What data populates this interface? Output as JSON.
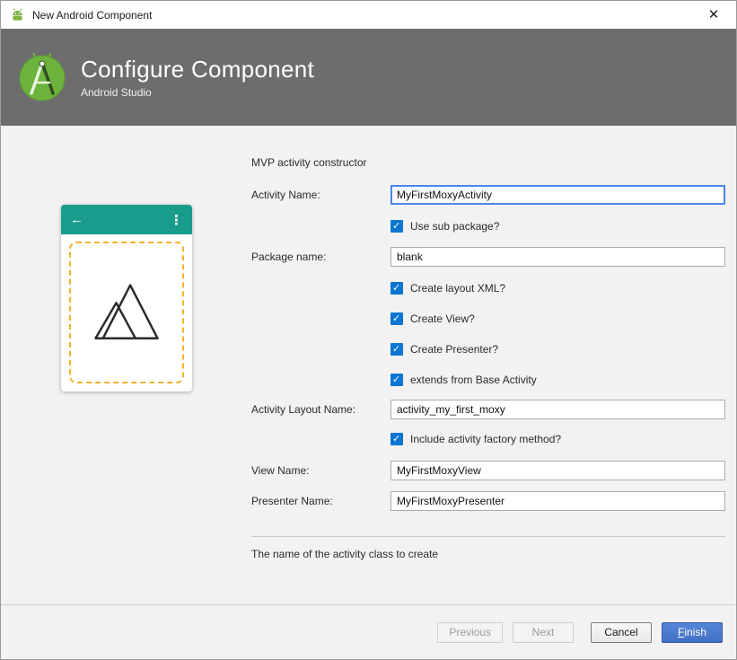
{
  "window": {
    "title": "New Android Component",
    "close_glyph": "✕"
  },
  "header": {
    "title": "Configure Component",
    "subtitle": "Android Studio"
  },
  "preview": {
    "back_glyph": "←",
    "overflow_glyph": "⋮"
  },
  "form": {
    "section_label": "MVP activity constructor",
    "activity_name": {
      "label": "Activity Name:",
      "value": "MyFirstMoxyActivity"
    },
    "use_sub_package": {
      "label": "Use sub package?",
      "checked": true
    },
    "package_name": {
      "label": "Package name:",
      "value": "blank"
    },
    "create_layout_xml": {
      "label": "Create layout XML?",
      "checked": true
    },
    "create_view": {
      "label": "Create View?",
      "checked": true
    },
    "create_presenter": {
      "label": "Create Presenter?",
      "checked": true
    },
    "extends_from_base_activity": {
      "label": "extends from Base Activity",
      "checked": true
    },
    "activity_layout_name": {
      "label": "Activity Layout Name:",
      "value": "activity_my_first_moxy"
    },
    "include_activity_factory_method": {
      "label": "Include activity factory method?",
      "checked": true
    },
    "view_name": {
      "label": "View Name:",
      "value": "MyFirstMoxyView"
    },
    "presenter_name": {
      "label": "Presenter Name:",
      "value": "MyFirstMoxyPresenter"
    },
    "help_text": "The name of the activity class to create"
  },
  "buttons": {
    "previous": "Previous",
    "next": "Next",
    "cancel": "Cancel",
    "finish": "Finish"
  },
  "colors": {
    "header_bg": "#6d6d6d",
    "teal_appbar": "#199c8c",
    "dashed_border": "#f3b229",
    "checkbox_blue": "#0b76d1",
    "finish_button": "#4a7bc8",
    "focus_border": "#4a86e8"
  }
}
